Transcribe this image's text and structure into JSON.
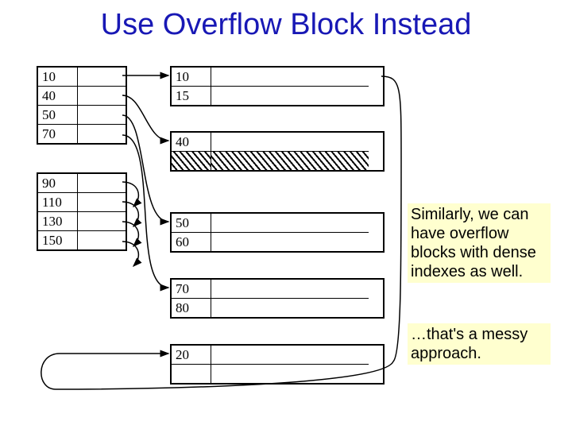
{
  "title": "Use Overflow Block Instead",
  "index_blocks": [
    {
      "keys": [
        "10",
        "40",
        "50",
        "70"
      ]
    },
    {
      "keys": [
        "90",
        "110",
        "130",
        "150"
      ]
    }
  ],
  "data_blocks": [
    {
      "rows": [
        "10",
        "15"
      ],
      "hatched": []
    },
    {
      "rows": [
        "40",
        ""
      ],
      "hatched": [
        1
      ]
    },
    {
      "rows": [
        "50",
        "60"
      ],
      "hatched": []
    },
    {
      "rows": [
        "70",
        "80"
      ],
      "hatched": []
    },
    {
      "rows": [
        "20",
        ""
      ],
      "hatched": []
    }
  ],
  "notes": {
    "note1": "Similarly, we can have overflow blocks with dense indexes as well.",
    "note2": "…that's a messy approach."
  }
}
